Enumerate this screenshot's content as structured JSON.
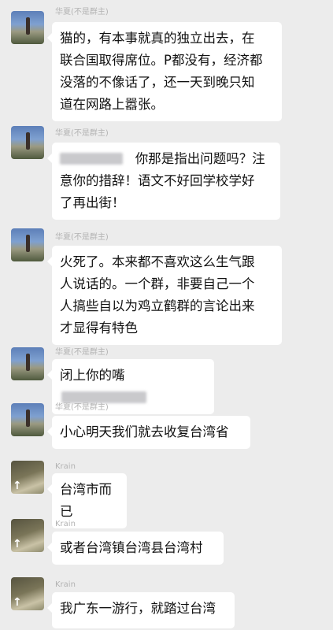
{
  "messages": [
    {
      "sender": "华夏(不是群主)",
      "lines": [
        "猫的，有本事就真的独立出去，在",
        "联合国取得席位。P都没有，经济都",
        "没落的不像话了，还一天到晚只知",
        "道在网路上嚣张。"
      ]
    },
    {
      "sender": "华夏(不是群主)",
      "lines": [
        "你那是指出问题吗？注",
        "意你的措辞！语文不好回学校学好",
        "了再出街！"
      ]
    },
    {
      "sender": "华夏(不是群主)",
      "lines": [
        "火死了。本来都不喜欢这么生气跟",
        "人说话的。一个群，非要自己一个",
        "人搞些自以为鸡立鹤群的言论出来",
        "才显得有特色"
      ]
    },
    {
      "sender": "华夏(不是群主)",
      "lines": [
        "闭上你的嘴"
      ]
    },
    {
      "sender": "华夏(不是群主)",
      "lines": [
        "小心明天我们就去收复台湾省"
      ]
    },
    {
      "sender": "Krain",
      "lines": [
        "台湾市而已"
      ]
    },
    {
      "sender": "Krain",
      "lines": [
        "或者台湾镇台湾县台湾村"
      ]
    },
    {
      "sender": "Krain",
      "lines": [
        "我广东一游行，就踏过台湾"
      ]
    }
  ]
}
